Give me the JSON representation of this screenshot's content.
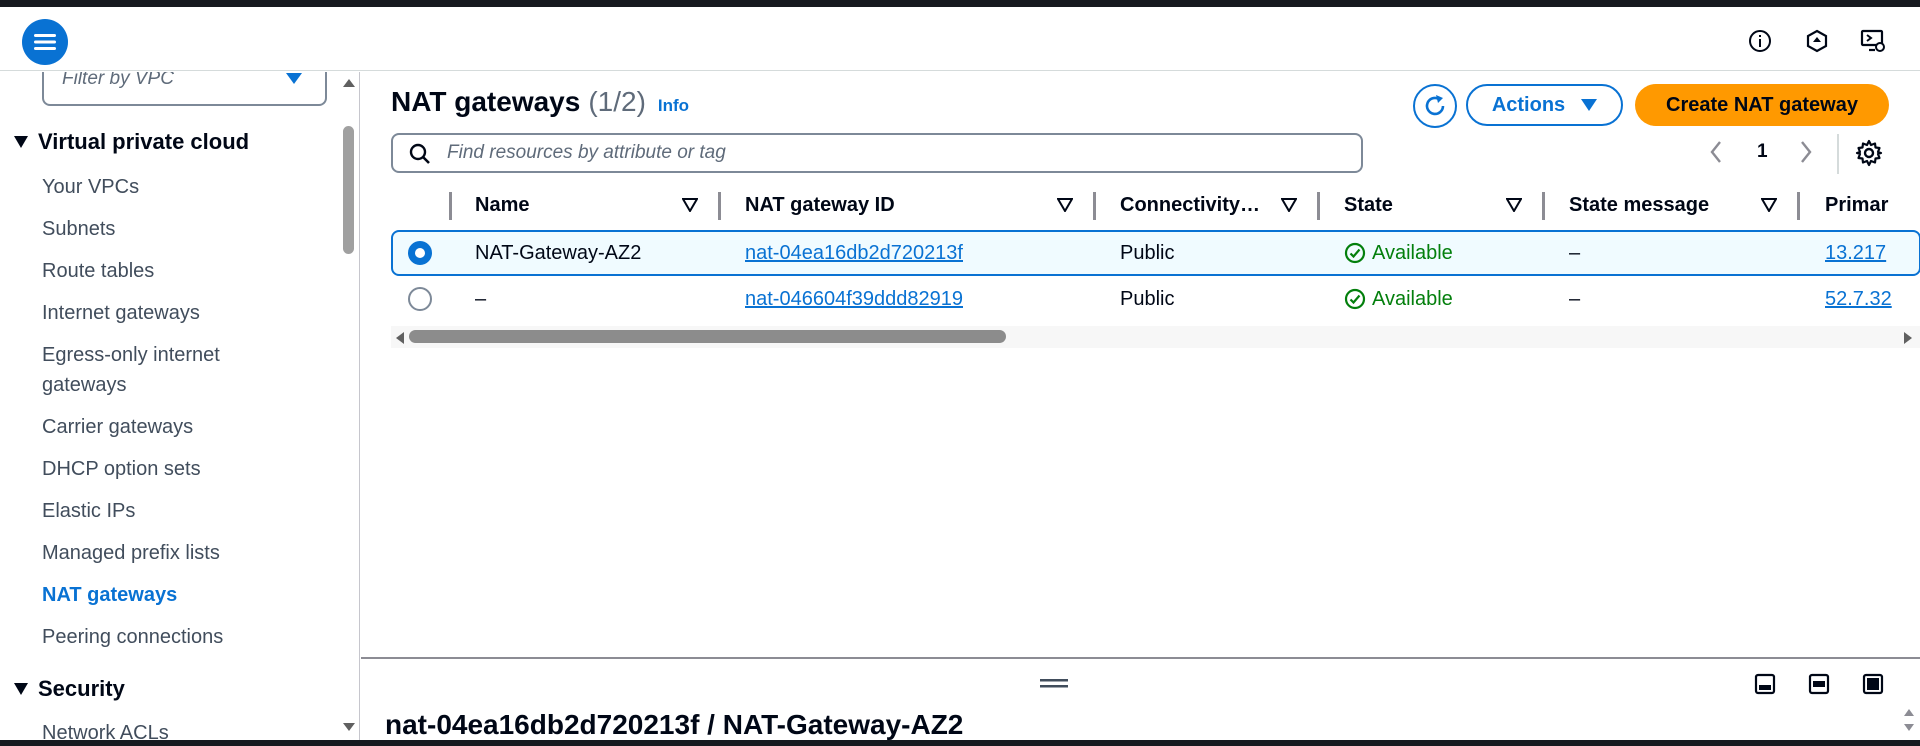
{
  "header": {
    "menu_icon": "hamburger-menu-icon",
    "icons": [
      "info-circle-icon",
      "notifications-icon",
      "display-preferences-icon"
    ]
  },
  "sidebar": {
    "filter_placeholder": "Filter by VPC",
    "sections": [
      {
        "label": "Virtual private cloud",
        "items": [
          "Your VPCs",
          "Subnets",
          "Route tables",
          "Internet gateways",
          "Egress-only internet gateways",
          "Carrier gateways",
          "DHCP option sets",
          "Elastic IPs",
          "Managed prefix lists",
          "NAT gateways",
          "Peering connections"
        ]
      },
      {
        "label": "Security",
        "items": [
          "Network ACLs"
        ]
      }
    ],
    "active_item": "NAT gateways"
  },
  "main": {
    "title": "NAT gateways",
    "count": "(1/2)",
    "info_link": "Info",
    "actions_label": "Actions",
    "create_label": "Create NAT gateway",
    "search_placeholder": "Find resources by attribute or tag",
    "page_number": "1",
    "columns": [
      "Name",
      "NAT gateway ID",
      "Connectivity…",
      "State",
      "State message",
      "Primar"
    ],
    "rows": [
      {
        "selected": true,
        "name": "NAT-Gateway-AZ2",
        "id": "nat-04ea16db2d720213f",
        "connectivity": "Public",
        "state": "Available",
        "state_message": "–",
        "primary": "13.217"
      },
      {
        "selected": false,
        "name": "–",
        "id": "nat-046604f39ddd82919",
        "connectivity": "Public",
        "state": "Available",
        "state_message": "–",
        "primary": "52.7.32"
      }
    ]
  },
  "split_panel": {
    "title": "nat-04ea16db2d720213f / NAT-Gateway-AZ2"
  },
  "colors": {
    "accent": "#0972d3",
    "primary_button": "#ff9900",
    "success": "#037f0c",
    "text": "#000716"
  }
}
